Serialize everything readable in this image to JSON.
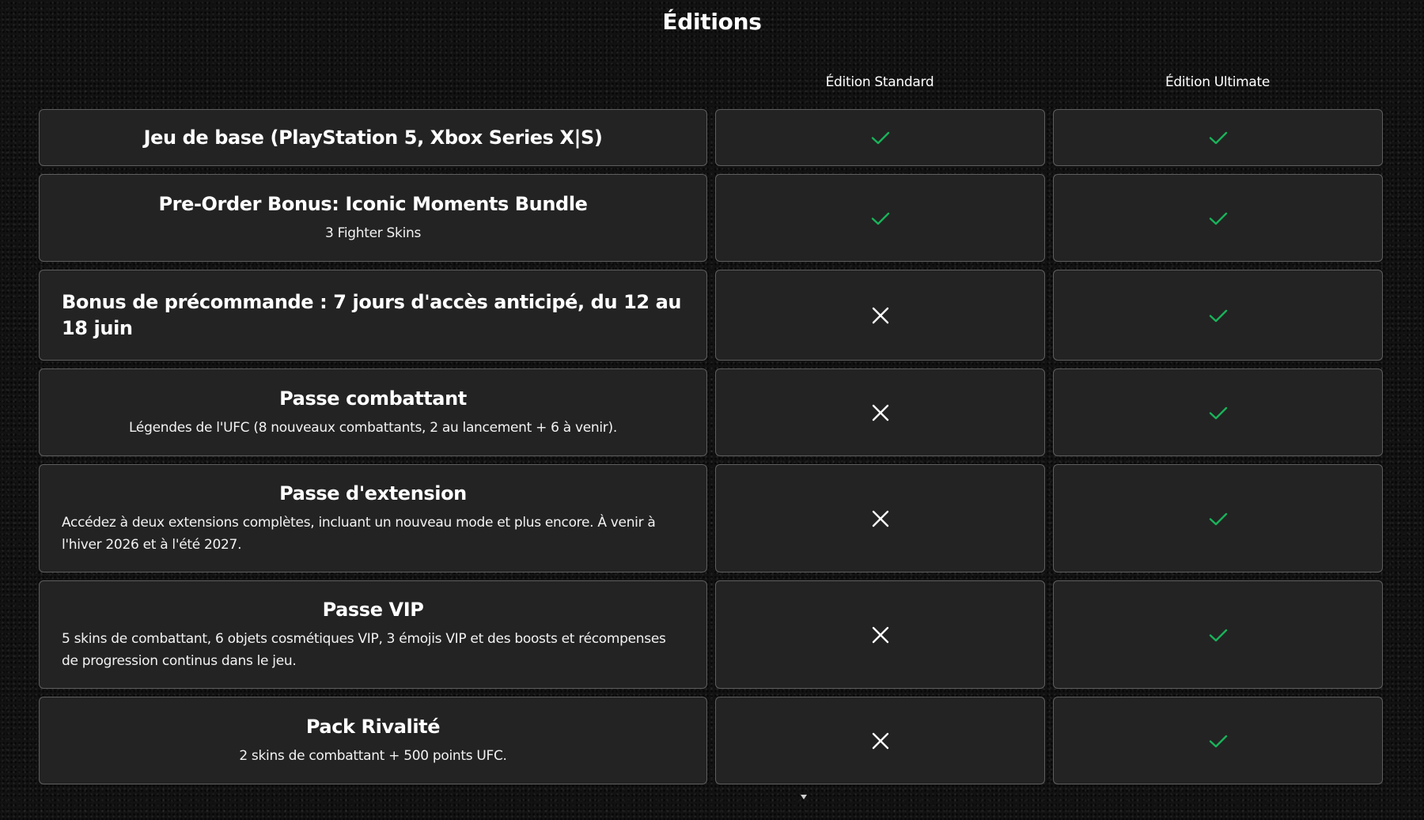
{
  "page": {
    "title": "Éditions"
  },
  "columns": {
    "standard": "Édition Standard",
    "ultimate": "Édition Ultimate"
  },
  "colors": {
    "check": "#19b35a",
    "cross": "#ffffff",
    "cell_background": "#232323",
    "cell_border": "#5e5e5e",
    "page_background": "#121212"
  },
  "rows": [
    {
      "title": "Jeu de base (PlayStation 5, Xbox Series X|S)",
      "description": "",
      "standard": "check-icon",
      "ultimate": "check-icon"
    },
    {
      "title": "Pre-Order Bonus: Iconic Moments Bundle",
      "description": "3 Fighter Skins",
      "standard": "check-icon",
      "ultimate": "check-icon"
    },
    {
      "title": "Bonus de précommande : 7 jours d'accès anticipé, du 12 au 18 juin",
      "description": "",
      "standard": "cross-icon",
      "ultimate": "check-icon"
    },
    {
      "title": "Passe combattant",
      "description": "Légendes de l'UFC (8 nouveaux combattants, 2 au lancement + 6 à venir).",
      "standard": "cross-icon",
      "ultimate": "check-icon"
    },
    {
      "title": "Passe d'extension",
      "description": "Accédez à deux extensions complètes, incluant un nouveau mode et plus encore. À venir à l'hiver 2026 et à l'été 2027.",
      "standard": "cross-icon",
      "ultimate": "check-icon"
    },
    {
      "title": "Passe VIP",
      "description": "5 skins de combattant, 6 objets cosmétiques VIP, 3 émojis VIP et des boosts et récompenses de progression continus dans le jeu.",
      "standard": "cross-icon",
      "ultimate": "check-icon"
    },
    {
      "title": "Pack Rivalité",
      "description": "2 skins de combattant + 500 points UFC.",
      "standard": "cross-icon",
      "ultimate": "check-icon"
    }
  ]
}
